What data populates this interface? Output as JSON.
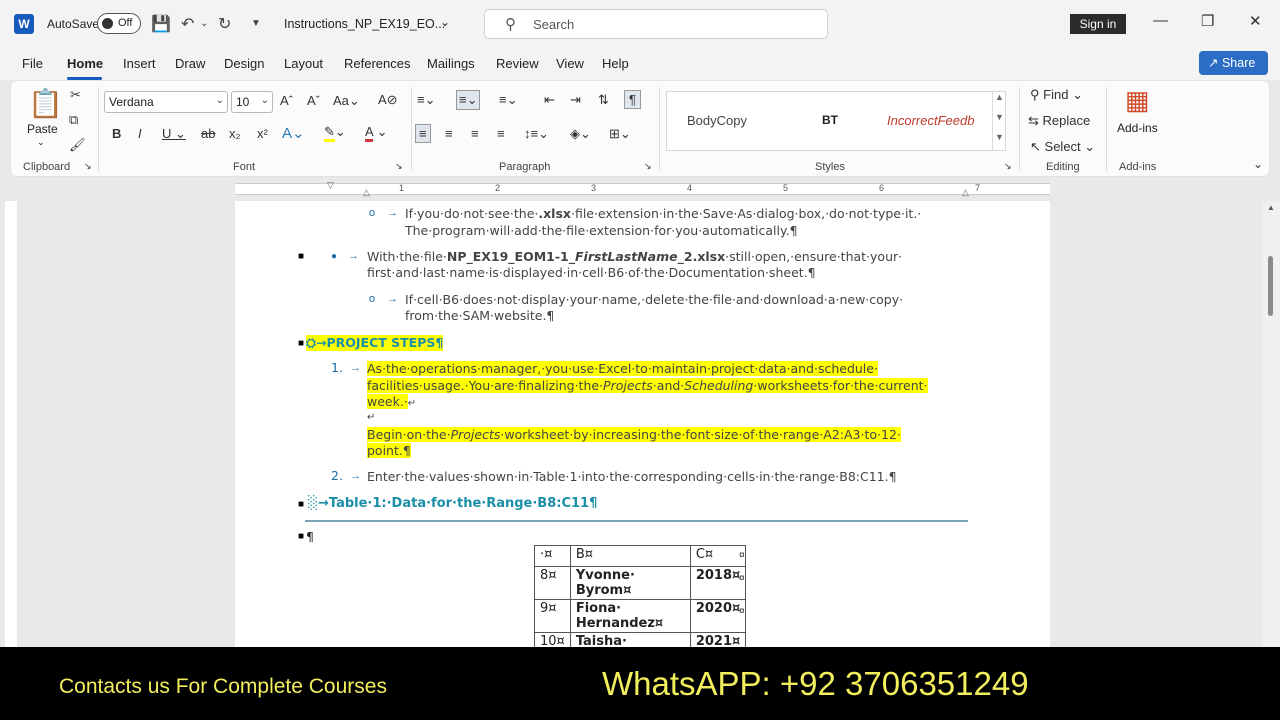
{
  "titlebar": {
    "app_letter": "W",
    "autosave_label": "AutoSave",
    "autosave_state": "Off",
    "doc_title": "Instructions_NP_EX19_EO...",
    "search_placeholder": "Search",
    "sign_in": "Sign in"
  },
  "menu": {
    "tabs": [
      "File",
      "Home",
      "Insert",
      "Draw",
      "Design",
      "Layout",
      "References",
      "Mailings",
      "Review",
      "View",
      "Help"
    ],
    "share": "Share"
  },
  "ribbon": {
    "clipboard_label": "Clipboard",
    "paste": "Paste",
    "font_label": "Font",
    "font_name": "Verdana",
    "font_size": "10",
    "paragraph_label": "Paragraph",
    "styles_label": "Styles",
    "styles": [
      "BodyCopy",
      "BT",
      "IncorrectFeedb"
    ],
    "editing_label": "Editing",
    "find": "Find",
    "replace": "Replace",
    "select": "Select",
    "addins_label": "Add-ins",
    "addins": "Add-ins"
  },
  "ruler": [
    "1",
    "2",
    "3",
    "4",
    "5",
    "6",
    "7"
  ],
  "doc": {
    "l1a": "If·you·do·not·see·the·",
    "l1b": ".xlsx",
    "l1c": "·file·extension·in·the·Save·As·dialog·box,·do·not·type·it.·",
    "l2": "The·program·will·add·the·file·extension·for·you·automatically.¶",
    "l3a": "With·the·file·",
    "l3b": "NP_EX19_EOM1-1_",
    "l3c": "FirstLastName",
    "l3d": "_2.xlsx",
    "l3e": "·still·open,·ensure·that·your·",
    "l4": "first·and·last·name·is·displayed·in·cell·B6·of·the·Documentation·sheet.¶",
    "l5": "If·cell·B6·does·not·display·your·name,·delete·the·file·and·download·a·new·copy·",
    "l6": "from·the·SAM·website.¶",
    "project_steps": "PROJECT STEPS¶",
    "step1_num": "1.",
    "s1a": "As·the·operations·manager,·you·use·Excel·to·maintain·project·data·and·schedule·",
    "s1b": "facilities·usage.·You·are·finalizing·the·",
    "s1c": "Projects",
    "s1d": "·and·",
    "s1e": "Scheduling",
    "s1f": "·worksheets·for·the·current·",
    "s1g": "week.·",
    "s1h": "Begin·on·the·",
    "s1i": "Projects",
    "s1j": "·worksheet·by·increasing·the·font·size·of·the·range·A2:A3·to·12·",
    "s1k": "point.¶",
    "step2_num": "2.",
    "s2": "Enter·the·values·shown·in·Table·1·into·the·corresponding·cells·in·the·range·B8:C11.¶",
    "table_heading": "Table·1:·Data·for·the·Range·B8:C11¶",
    "pilcrow": "¶"
  },
  "table": {
    "header": [
      "·¤",
      "B¤",
      "C¤"
    ],
    "rows": [
      [
        "8¤",
        "Yvonne· Byrom¤",
        "2018¤"
      ],
      [
        "9¤",
        "Fiona· Hernandez¤",
        "2020¤"
      ],
      [
        "10¤",
        "Taisha·",
        "2021¤"
      ]
    ]
  },
  "footer": {
    "left": "Contacts us For Complete Courses",
    "right": "WhatsAPP:  +92 3706351249"
  }
}
